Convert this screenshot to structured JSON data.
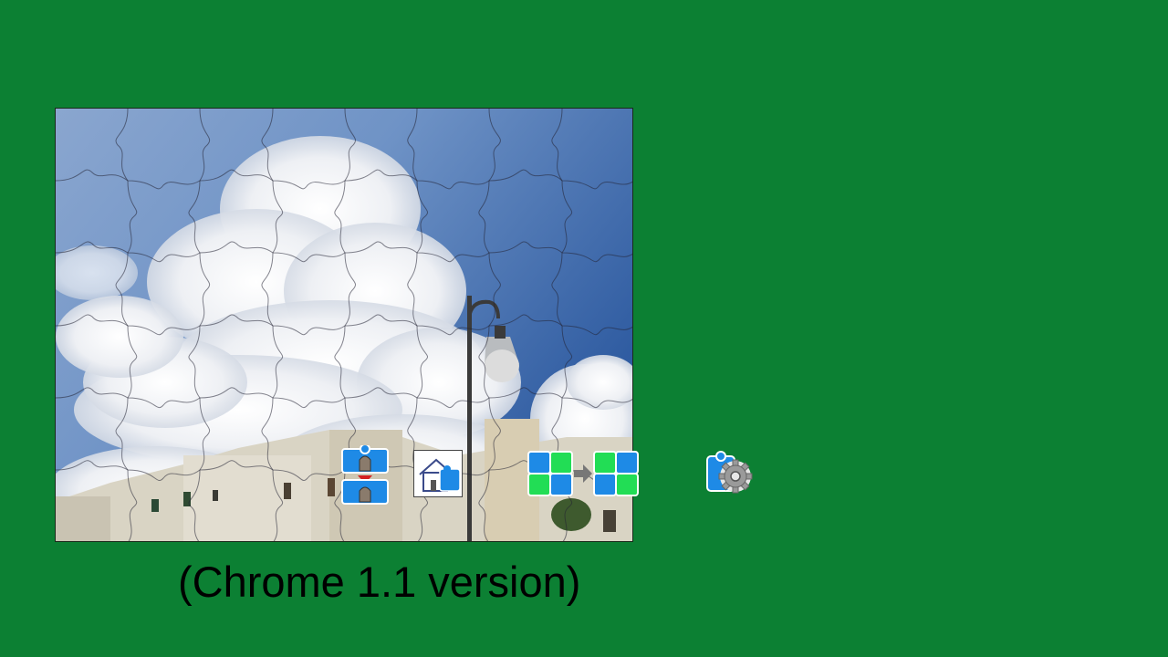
{
  "background_color": "#0c8033",
  "version_label": "(Chrome 1.1 version)",
  "puzzle": {
    "grid_columns": 8,
    "grid_rows": 6,
    "scene": "sky with cumulus clouds, white buildings and a street lamp"
  },
  "toolbar": {
    "sort_pieces_icon": "sort-pieces-icon",
    "show_preview_icon": "show-preview-icon",
    "change_pieces_icon": "change-pieces-icon",
    "settings_icon": "settings-gear-icon"
  },
  "colors": {
    "piece_blue": "#1e8ae6",
    "piece_green": "#22dd55",
    "arrow_red": "#d42020",
    "gear_gray": "#9a9a9a"
  }
}
